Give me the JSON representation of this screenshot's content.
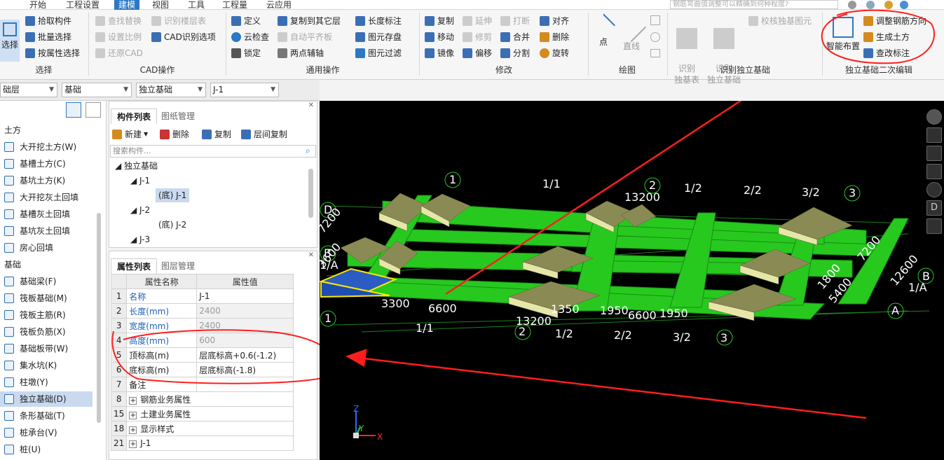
{
  "menu": {
    "tabs": [
      "开始",
      "工程设置",
      "建模",
      "视图",
      "工具",
      "工程量",
      "云应用"
    ],
    "active": "建模",
    "search_placeholder": "钢筋弯曲值调整可以精确到何种程度?"
  },
  "ribbon": {
    "select": {
      "big_label": "选择",
      "pick": "拾取构件",
      "batch": "批量选择",
      "by_attr": "按属性选择",
      "group": "选择"
    },
    "cad": {
      "find_replace": "查找替换",
      "set_scale": "设置比例",
      "restore": "还原CAD",
      "recognize_floor": "识别楼层表",
      "cad_options": "CAD识别选项",
      "group": "CAD操作"
    },
    "common": {
      "define": "定义",
      "cloud_check": "云检查",
      "lock": "锁定",
      "copy_other": "复制到其它层",
      "auto_align": "自动平齐板",
      "two_point_axis": "两点辅轴",
      "length_mark": "长度标注",
      "element_save": "图元存盘",
      "element_filter": "图元过滤",
      "group": "通用操作"
    },
    "modify": {
      "copy": "复制",
      "move": "移动",
      "mirror": "镜像",
      "extend": "延伸",
      "trim": "修剪",
      "offset": "偏移",
      "break": "打断",
      "merge": "合并",
      "split": "分割",
      "align": "对齐",
      "delete": "删除",
      "rotate": "旋转",
      "group": "修改"
    },
    "draw": {
      "point": "点",
      "line": "直线",
      "group": "绘图"
    },
    "recognize": {
      "recognize_table": "识别\n独基表",
      "recognize_found": "识别\n独立基础",
      "check_drawing": "校核独基图元",
      "group": "识别独立基础"
    },
    "secondary": {
      "smart_layout": "智能布置",
      "adjust_rebar": "调整钢筋方向",
      "gen_earth": "生成土方",
      "check_mark": "查改标注",
      "group": "独立基础二次编辑"
    }
  },
  "selectors": [
    "础层",
    "基础",
    "独立基础",
    "J-1"
  ],
  "leftnav": {
    "head1": "土方",
    "earth": [
      "大开挖土方(W)",
      "基槽土方(C)",
      "基坑土方(K)",
      "大开挖灰土回填",
      "基槽灰土回填",
      "基坑灰土回填",
      "房心回填"
    ],
    "head2": "基础",
    "found": [
      "基础梁(F)",
      "筏板基础(M)",
      "筏板主筋(R)",
      "筏板负筋(X)",
      "基础板带(W)",
      "集水坑(K)",
      "柱墩(Y)",
      "独立基础(D)",
      "条形基础(T)",
      "桩承台(V)",
      "桩(U)"
    ],
    "selected": "独立基础(D)"
  },
  "complist": {
    "tab1": "构件列表",
    "tab2": "图纸管理",
    "new": "新建",
    "delete": "删除",
    "copy": "复制",
    "floor_copy": "层间复制",
    "search_placeholder": "搜索构件...",
    "tree": [
      "独立基础",
      "J-1",
      "(底) J-1",
      "J-2",
      "(底) J-2",
      "J-3"
    ]
  },
  "props": {
    "tab1": "属性列表",
    "tab2": "图层管理",
    "col_name": "属性名称",
    "col_value": "属性值",
    "rows": [
      {
        "n": "1",
        "name": "名称",
        "value": "J-1"
      },
      {
        "n": "2",
        "name": "长度(mm)",
        "value": "2400"
      },
      {
        "n": "3",
        "name": "宽度(mm)",
        "value": "2400"
      },
      {
        "n": "4",
        "name": "高度(mm)",
        "value": "600"
      },
      {
        "n": "5",
        "name": "顶标高(m)",
        "value": "层底标高+0.6(-1.2)"
      },
      {
        "n": "6",
        "name": "底标高(m)",
        "value": "层底标高(-1.8)"
      },
      {
        "n": "7",
        "name": "备注",
        "value": ""
      },
      {
        "n": "8",
        "name": "钢筋业务属性",
        "value": ""
      },
      {
        "n": "15",
        "name": "土建业务属性",
        "value": ""
      },
      {
        "n": "18",
        "name": "显示样式",
        "value": ""
      },
      {
        "n": "21",
        "name": "J-1",
        "value": ""
      }
    ]
  },
  "viewport": {
    "axis_top": [
      "1",
      "1/1",
      "2",
      "1/2",
      "2/2",
      "3/2",
      "3"
    ],
    "axis_bottom": [
      "1",
      "1/1",
      "2",
      "1/2",
      "2/2",
      "3/2",
      "3"
    ],
    "axis_left": [
      "D",
      "B",
      "1/A"
    ],
    "axis_right": [
      "B",
      "1/A",
      "A"
    ],
    "dims_top": [
      "13200"
    ],
    "dims_bottom": [
      "3300",
      "6600",
      "1350",
      "1950",
      "6600",
      "1950",
      "13200"
    ],
    "dims_left": [
      "7200",
      "3600"
    ],
    "dims_right": [
      "7200",
      "12600",
      "1800",
      "5400"
    ],
    "triad": {
      "z": "Z",
      "y": "Y",
      "x": "X"
    },
    "view_badge": "D"
  },
  "colors": {
    "beam": "#27c91f",
    "footing": "#b5b57a",
    "highlight": "#ffe800",
    "annotation": "#ff1e1e",
    "accent": "#2b78c5"
  }
}
